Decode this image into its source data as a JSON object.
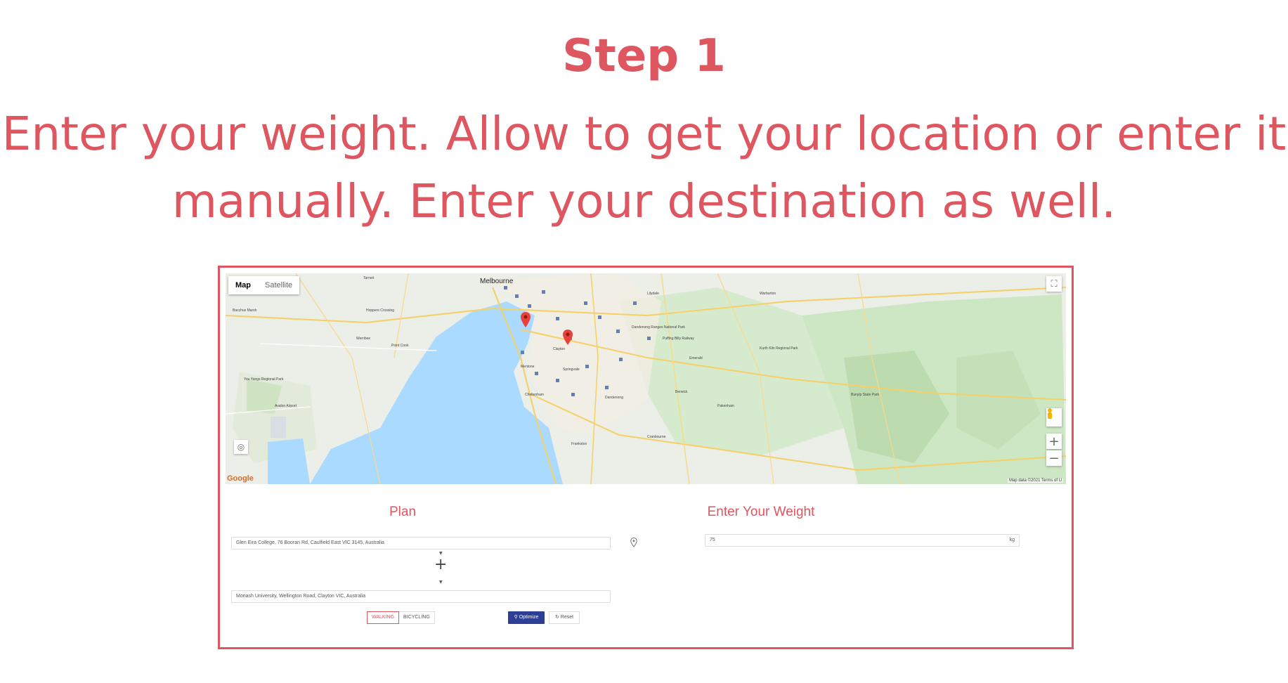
{
  "header": {
    "step_title": "Step 1",
    "instruction_line1": "Enter your weight. Allow to get your location or enter it",
    "instruction_line2": "manually. Enter your destination as well.",
    "accent_color": "#dd5660"
  },
  "map": {
    "type_control": {
      "map_label": "Map",
      "satellite_label": "Satellite",
      "selected": "Map"
    },
    "logo_text": "Google",
    "footer_text": "Map data ©2021   Terms of U",
    "labels": {
      "melbourne": "Melbourne",
      "clayton": "Clayton",
      "werribee": "Werribee",
      "dandenong": "Dandenong",
      "avalon_airport": "Avalon Airport",
      "you_yangs": "You Yangs Regional Park",
      "dandenong_ranges": "Dandenong Ranges National Park",
      "puffing_billy": "Puffing Billy Railway",
      "frankston": "Frankston",
      "bunyip": "Bunyip State Park",
      "kurth_kiln": "Kurth Kiln Regional Park",
      "cheltenham": "Cheltenham",
      "springvale": "Springvale",
      "emerald": "Emerald",
      "berwick": "Berwick",
      "pakenham": "Pakenham",
      "mentone": "Mentone",
      "lilydale": "Lilydale",
      "warburton": "Warburton",
      "cranbourne": "Cranbourne",
      "point_cook": "Point Cook",
      "tarneit": "Tarneit",
      "hoppers_crossing": "Hoppers Crossing",
      "bacchus_marsh": "Bacchus Marsh"
    },
    "markers": [
      "origin-marker",
      "destination-marker"
    ],
    "icons": [
      "fullscreen-icon",
      "pegman-icon",
      "zoom-in-icon",
      "zoom-out-icon",
      "my-location-icon"
    ]
  },
  "plan": {
    "title": "Plan",
    "origin_value": "Glen Eira College, 76 Booran Rd, Caulfield East VIC 3145, Australia",
    "destination_value": "Monash University, Wellington Road, Clayton VIC, Australia",
    "swap_symbol": "+",
    "modes": {
      "walking": "WALKING",
      "bicycling": "BICYCLING",
      "selected": "WALKING"
    },
    "optimize_label": "Optimize",
    "reset_label": "Reset"
  },
  "weight": {
    "title": "Enter Your Weight",
    "value": "75",
    "unit": "kg"
  }
}
